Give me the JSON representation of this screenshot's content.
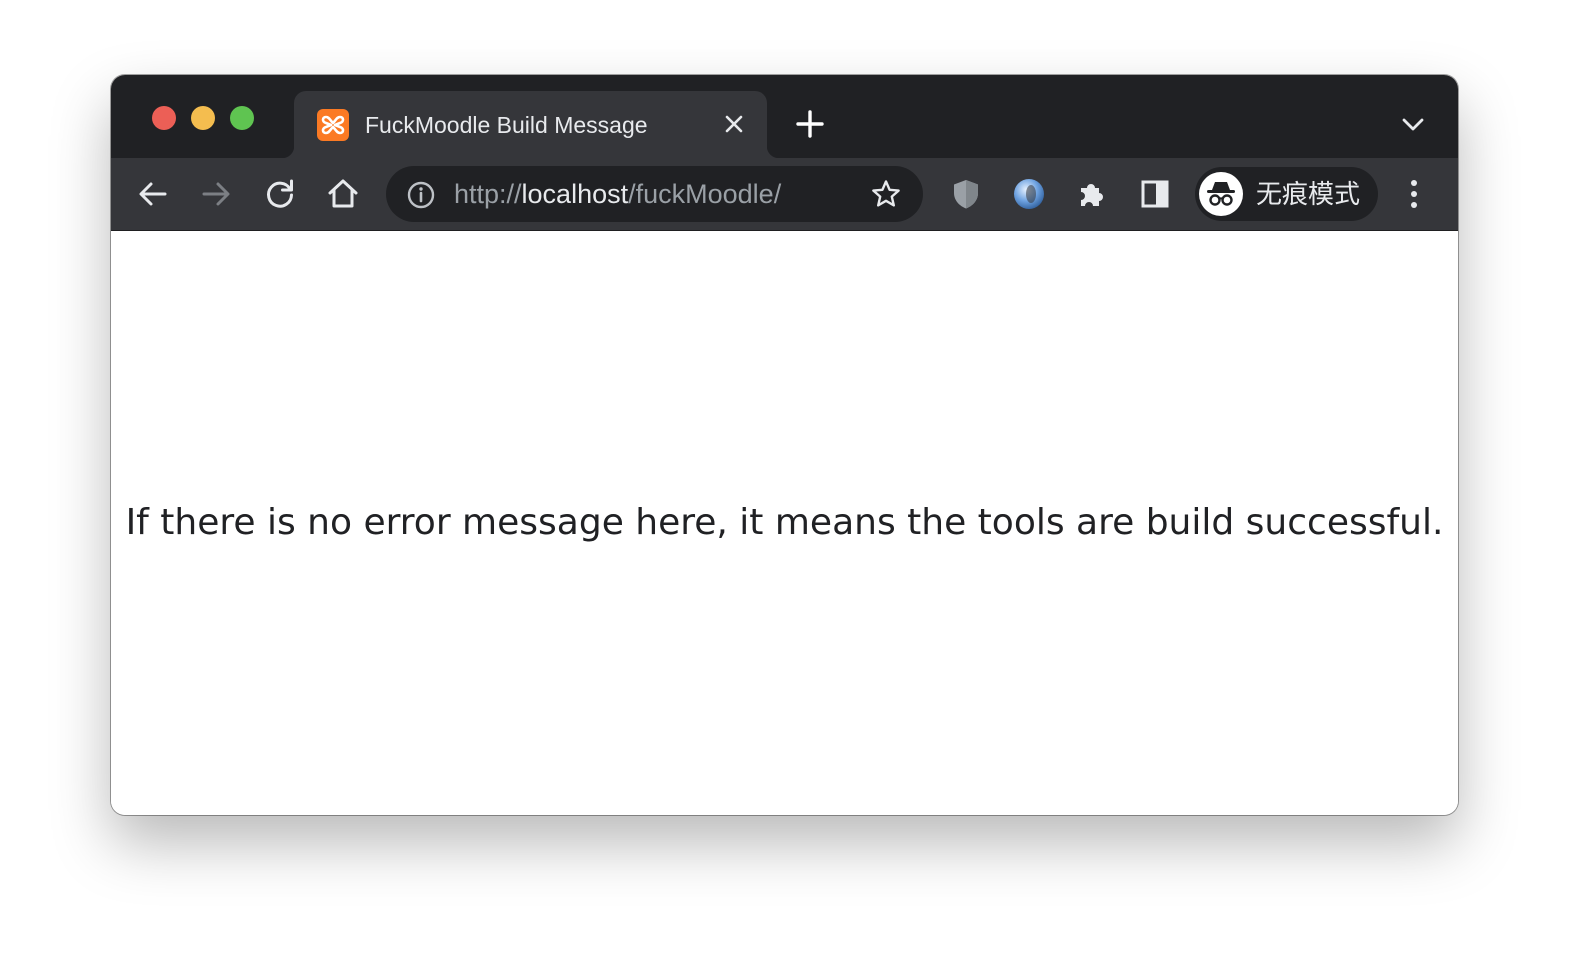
{
  "window": {
    "traffic_lights": [
      "close",
      "minimize",
      "zoom"
    ]
  },
  "tab": {
    "title": "FuckMoodle Build Message",
    "favicon": "xampp-icon",
    "favicon_color": "#fb7a24"
  },
  "tabstrip": {
    "new_tab_icon": "plus-icon",
    "tab_search_icon": "chevron-down-icon"
  },
  "toolbar": {
    "back_icon": "arrow-left-icon",
    "forward_icon": "arrow-right-icon",
    "reload_icon": "reload-icon",
    "home_icon": "home-icon",
    "extensions": [
      "shield-icon",
      "orb-extension-icon",
      "puzzle-icon",
      "side-panel-icon"
    ],
    "menu_icon": "kebab-menu-icon"
  },
  "omnibox": {
    "scheme": "http://",
    "host": "localhost",
    "path": "/fuckMoodle/",
    "info_icon": "info-icon",
    "bookmark_icon": "star-icon"
  },
  "profile": {
    "label": "无痕模式",
    "icon": "incognito-icon"
  },
  "page": {
    "message": "If there is no error message here, it means the tools are build successful."
  },
  "colors": {
    "tabstrip_bg": "#202124",
    "toolbar_bg": "#35363a",
    "text_light": "#e8eaed",
    "text_dim": "#9aa0a6"
  }
}
